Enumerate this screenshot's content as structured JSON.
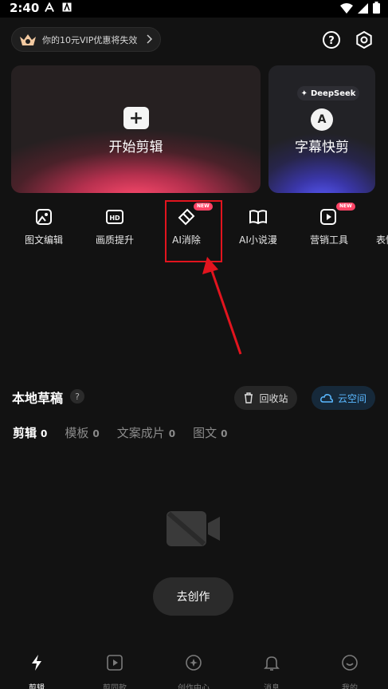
{
  "status_bar": {
    "time": "2:40",
    "left_icons": [
      "a-app-icon",
      "a-square-icon"
    ]
  },
  "header": {
    "vip_text": "你的10元VIP优惠将失效",
    "vip_badge": "VIP",
    "right_icons": [
      "help-icon",
      "settings-icon"
    ]
  },
  "cards": {
    "main": {
      "label": "开始剪辑"
    },
    "side": {
      "tag": "DeepSeek",
      "badge_letter": "A",
      "label": "字幕快剪"
    }
  },
  "tools": [
    {
      "label": "图文编辑",
      "icon": "image-edit-icon",
      "new": false
    },
    {
      "label": "画质提升",
      "icon": "hd-icon",
      "new": false
    },
    {
      "label": "AI消除",
      "icon": "eraser-icon",
      "new": true
    },
    {
      "label": "AI小说漫",
      "icon": "book-sparkle-icon",
      "new": false
    },
    {
      "label": "营销工具",
      "icon": "play-sparkle-icon",
      "new": true
    },
    {
      "label": "表情",
      "icon": "more-icon",
      "new": false
    }
  ],
  "new_badge": "NEW",
  "drafts": {
    "title": "本地草稿",
    "help": "?",
    "recycle_label": "回收站",
    "cloud_label": "云空间",
    "tabs": [
      {
        "label": "剪辑",
        "count": "0",
        "active": true
      },
      {
        "label": "模板",
        "count": "0",
        "active": false
      },
      {
        "label": "文案成片",
        "count": "0",
        "active": false
      },
      {
        "label": "图文",
        "count": "0",
        "active": false
      }
    ],
    "create_label": "去创作"
  },
  "bottom_nav": [
    {
      "label": "剪辑",
      "icon": "clip-icon",
      "active": true
    },
    {
      "label": "剪同款",
      "icon": "template-icon",
      "active": false
    },
    {
      "label": "创作中心",
      "icon": "creator-icon",
      "active": false
    },
    {
      "label": "消息",
      "icon": "bell-icon",
      "active": false
    },
    {
      "label": "我的",
      "icon": "profile-icon",
      "active": false
    }
  ],
  "colors": {
    "accent_red": "#e2141e",
    "cloud_blue": "#5ab8ff",
    "new_badge": "#ff4466"
  }
}
